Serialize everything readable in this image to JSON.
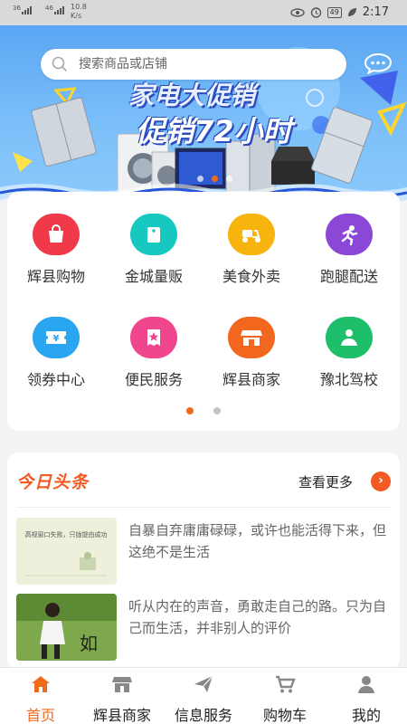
{
  "status_bar": {
    "network1": "36",
    "network2": "46",
    "speed_value": "10.8",
    "speed_unit": "K/s",
    "battery": "49",
    "time": "2:17"
  },
  "header": {
    "search_placeholder": "搜索商品或店铺",
    "message_icon": "chat-bubble-icon"
  },
  "banner": {
    "title_line1": "家电大促销",
    "title_line2": "促销72小时",
    "page_count": 3,
    "active_page": 2
  },
  "categories": {
    "items": [
      {
        "label": "辉县购物",
        "icon": "shopping-bag-icon",
        "color": "#f03a4a"
      },
      {
        "label": "金城量贩",
        "icon": "price-tag-icon",
        "color": "#16c8c0"
      },
      {
        "label": "美食外卖",
        "icon": "scooter-icon",
        "color": "#f7b40e"
      },
      {
        "label": "跑腿配送",
        "icon": "runner-icon",
        "color": "#8b48d6"
      },
      {
        "label": "领券中心",
        "icon": "coupon-icon",
        "color": "#2aa5f0"
      },
      {
        "label": "便民服务",
        "icon": "star-ticket-icon",
        "color": "#f0468e"
      },
      {
        "label": "辉县商家",
        "icon": "store-icon",
        "color": "#f2661d"
      },
      {
        "label": "豫北驾校",
        "icon": "driver-icon",
        "color": "#1dbf6a"
      }
    ],
    "page_count": 2,
    "active_page": 1
  },
  "news": {
    "title": "今日头条",
    "more_label": "查看更多",
    "items": [
      {
        "text": "自暴自弃庸庸碌碌，或许也能活得下来，但这绝不是生活",
        "thumb_caption": "高视窗口失败，只拢提由成功"
      },
      {
        "text": "听从内在的声音，勇敢走自己的路。只为自己而生活，并非别人的评价",
        "thumb_caption": "如"
      }
    ]
  },
  "tabbar": {
    "items": [
      {
        "label": "首页",
        "icon": "home-icon"
      },
      {
        "label": "辉县商家",
        "icon": "shop-icon"
      },
      {
        "label": "信息服务",
        "icon": "paper-plane-icon"
      },
      {
        "label": "购物车",
        "icon": "cart-icon"
      },
      {
        "label": "我的",
        "icon": "user-icon"
      }
    ],
    "active": 0,
    "accent": "#f06a1c"
  }
}
